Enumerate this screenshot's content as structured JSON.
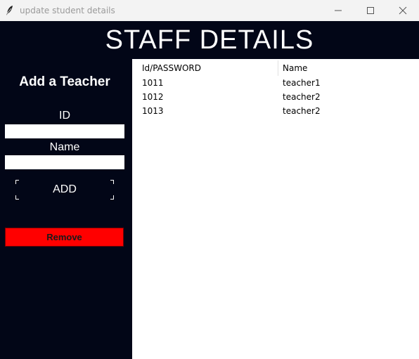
{
  "window": {
    "title": "update student details",
    "icon": "feather-icon",
    "controls": [
      "minimize-icon",
      "maximize-icon",
      "close-icon"
    ]
  },
  "header": {
    "title": "STAFF DETAILS"
  },
  "sidebar": {
    "heading": "Add a Teacher",
    "id_label": "ID",
    "id_value": "",
    "name_label": "Name",
    "name_value": "",
    "add_label": "ADD",
    "remove_label": "Remove"
  },
  "table": {
    "columns": [
      "Id/PASSWORD",
      "Name"
    ],
    "rows": [
      [
        "1011",
        "teacher1"
      ],
      [
        "1012",
        "teacher2"
      ],
      [
        "1013",
        "teacher2"
      ]
    ]
  },
  "colors": {
    "background_dark": "#020617",
    "remove_red": "#ff0000",
    "titlebar": "#f3f3f3"
  }
}
